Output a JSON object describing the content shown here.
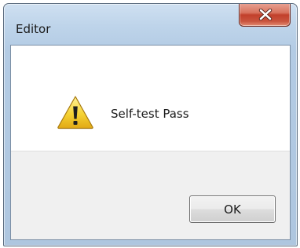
{
  "window": {
    "title": "Editor",
    "close_icon": "close-icon"
  },
  "dialog": {
    "icon": "warning-icon",
    "message": "Self-test Pass",
    "ok_label": "OK"
  },
  "colors": {
    "close_button": "#c9553f",
    "title_bar": "#bed4ea",
    "footer": "#f0f0f0",
    "warning_yellow": "#f5d233"
  }
}
